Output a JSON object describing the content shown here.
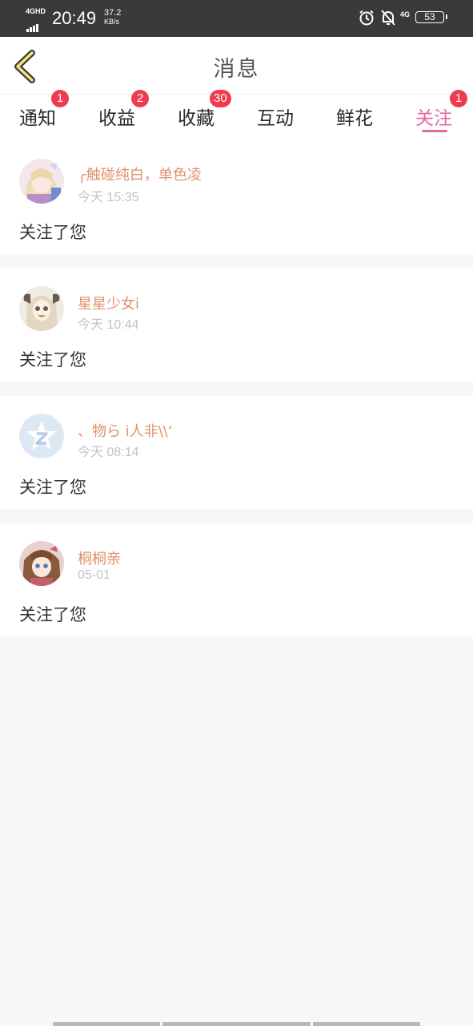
{
  "status_bar": {
    "network_label": "4GHD",
    "time": "20:49",
    "speed_value": "37.2",
    "speed_unit": "KB/s",
    "mobile_data_label": "4G",
    "battery": "53"
  },
  "header": {
    "title": "消息"
  },
  "tabs": [
    {
      "label": "通知",
      "badge": "1"
    },
    {
      "label": "收益",
      "badge": "2"
    },
    {
      "label": "收藏",
      "badge": "30"
    },
    {
      "label": "互动",
      "badge": ""
    },
    {
      "label": "鲜花",
      "badge": ""
    },
    {
      "label": "关注",
      "badge": "1",
      "active": true
    }
  ],
  "notifications": [
    {
      "username": "╭触碰纯白，单色凌",
      "time": "今天 15:35",
      "action": "关注了您",
      "avatar_icon": "anime-girl-avatar"
    },
    {
      "username": "星星少女i",
      "time": "今天 10:44",
      "action": "关注了您",
      "avatar_icon": "anime-girl-avatar"
    },
    {
      "username": "、物ら i人非\\\\‘",
      "time": "今天 08:14",
      "action": "关注了您",
      "avatar_icon": "default-star-avatar"
    },
    {
      "username": "桐桐亲",
      "time": "05-01",
      "action": "关注了您",
      "avatar_icon": "anime-girl-avatar"
    }
  ],
  "colors": {
    "accent": "#e46a9f",
    "badge": "#f03a52",
    "username": "#e0926a"
  }
}
